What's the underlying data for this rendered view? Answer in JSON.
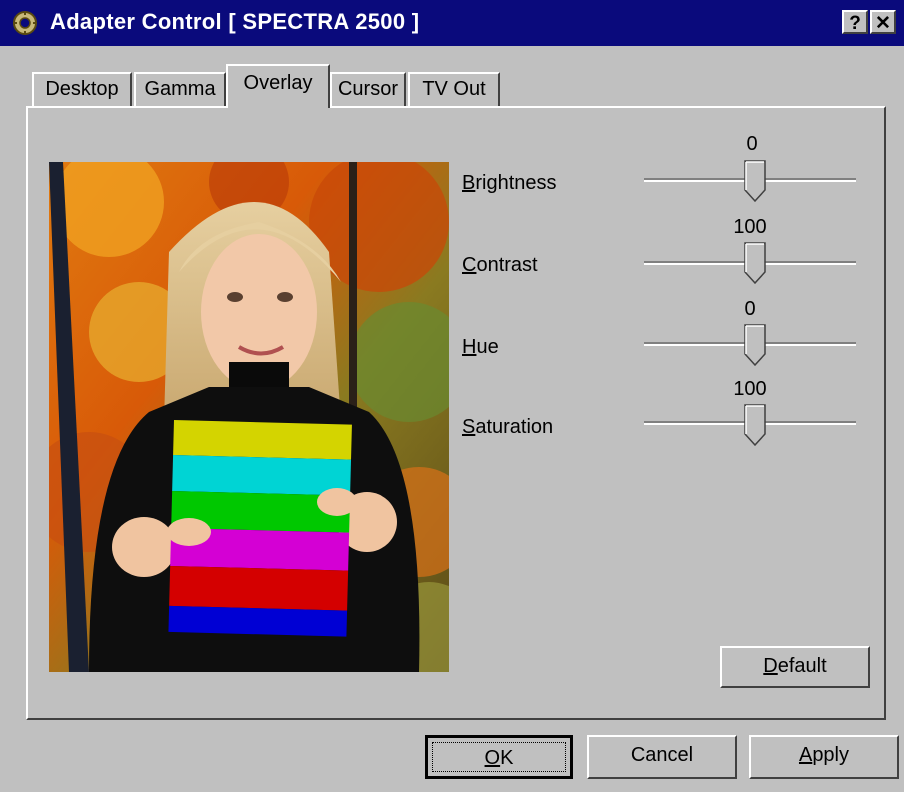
{
  "window": {
    "title": "Adapter Control [ SPECTRA 2500 ]",
    "help_label": "?",
    "close_label": "✕"
  },
  "tabs": [
    {
      "label": "Desktop",
      "active": false
    },
    {
      "label": "Gamma",
      "active": false
    },
    {
      "label": "Overlay",
      "active": true
    },
    {
      "label": "Cursor",
      "active": false
    },
    {
      "label": "TV Out",
      "active": false
    }
  ],
  "sliders": [
    {
      "label": "Brightness",
      "accel": "B",
      "rest": "rightness",
      "value": "0",
      "level": 0.5
    },
    {
      "label": "Contrast",
      "accel": "C",
      "rest": "ontrast",
      "value": "100",
      "level": 0.5
    },
    {
      "label": "Hue",
      "accel": "H",
      "rest": "ue",
      "value": "0",
      "level": 0.5
    },
    {
      "label": "Saturation",
      "accel": "S",
      "rest": "aturation",
      "value": "100",
      "level": 0.5
    }
  ],
  "buttons": {
    "default": {
      "accel": "D",
      "rest": "efault"
    },
    "ok": {
      "accel": "O",
      "rest": "K"
    },
    "cancel": {
      "label": "Cancel"
    },
    "apply": {
      "accel": "A",
      "rest": "pply"
    }
  },
  "colors": {
    "titlebar": "#0a0a7c",
    "dialog": "#c0c0c0",
    "test_bars": [
      "#d4d400",
      "#00d4d4",
      "#00c800",
      "#d400d4",
      "#d40000",
      "#0000d4"
    ]
  },
  "icons": {
    "app": "adapter-gear-icon",
    "help": "help-icon",
    "close": "close-icon"
  }
}
